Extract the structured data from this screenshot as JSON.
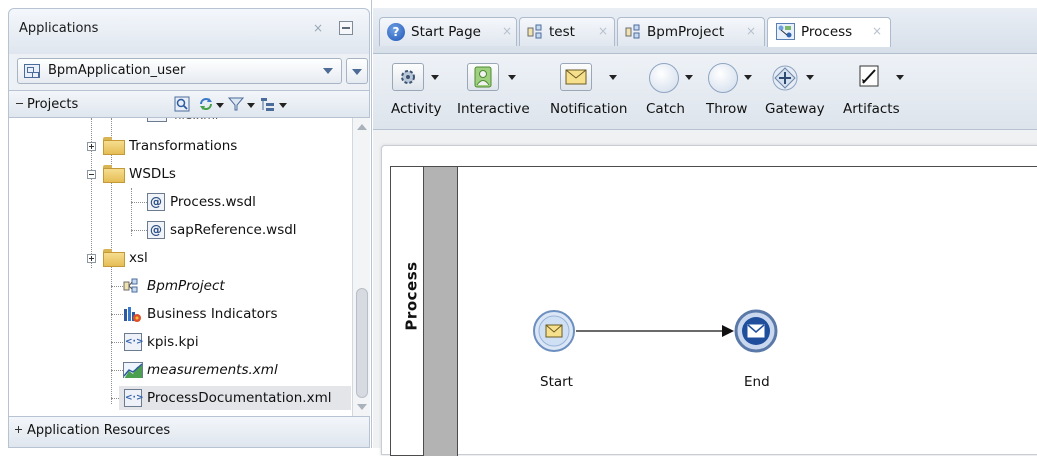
{
  "left_panel": {
    "header_title": "Applications",
    "close_glyph": "×",
    "application_select": "BpmApplication_user",
    "projects_label": "Projects",
    "tree": [
      {
        "label": "Transformations",
        "kind": "folder",
        "expand": "+"
      },
      {
        "label": "WSDLs",
        "kind": "folder",
        "expand": "-"
      },
      {
        "label": "Process.wsdl",
        "kind": "wsdl"
      },
      {
        "label": "sapReference.wsdl",
        "kind": "wsdl"
      },
      {
        "label": "xsl",
        "kind": "folder",
        "expand": "+"
      },
      {
        "label": "BpmProject",
        "kind": "bpm-project",
        "italic": true
      },
      {
        "label": "Business Indicators",
        "kind": "business-indicators"
      },
      {
        "label": "kpis.kpi",
        "kind": "xml"
      },
      {
        "label": "measurements.xml",
        "kind": "chart",
        "italic": true
      },
      {
        "label": "ProcessDocumentation.xml",
        "kind": "xml",
        "selected": true
      }
    ],
    "app_resources_label": "Application Resources",
    "wsdl_glyph": "@",
    "xml_glyph": "<·>"
  },
  "tabs": [
    {
      "label": "Start Page",
      "icon": "help-icon",
      "active": false
    },
    {
      "label": "test",
      "icon": "bpm-project-icon",
      "active": false
    },
    {
      "label": "BpmProject",
      "icon": "bpm-project-icon",
      "active": false
    },
    {
      "label": "Process",
      "icon": "process-icon",
      "active": true
    }
  ],
  "tab_close_glyph": "×",
  "help_glyph": "?",
  "toolbar": {
    "items": [
      {
        "label": "Activity",
        "icon": "gear-icon"
      },
      {
        "label": "Interactive",
        "icon": "user-icon"
      },
      {
        "label": "Notification",
        "icon": "envelope-icon"
      },
      {
        "label": "Catch",
        "icon": "event-circle-icon"
      },
      {
        "label": "Throw",
        "icon": "event-circle-icon"
      },
      {
        "label": "Gateway",
        "icon": "gateway-icon"
      },
      {
        "label": "Artifacts",
        "icon": "annotation-icon"
      }
    ]
  },
  "canvas": {
    "lane_title": "Process",
    "start_label": "Start",
    "end_label": "End"
  },
  "colors": {
    "panel_bg": "#dfe6ef",
    "lane_gray": "#b3b3b3",
    "event_fill": "#cfe0f5",
    "end_event_fill": "#1f4e9c"
  }
}
